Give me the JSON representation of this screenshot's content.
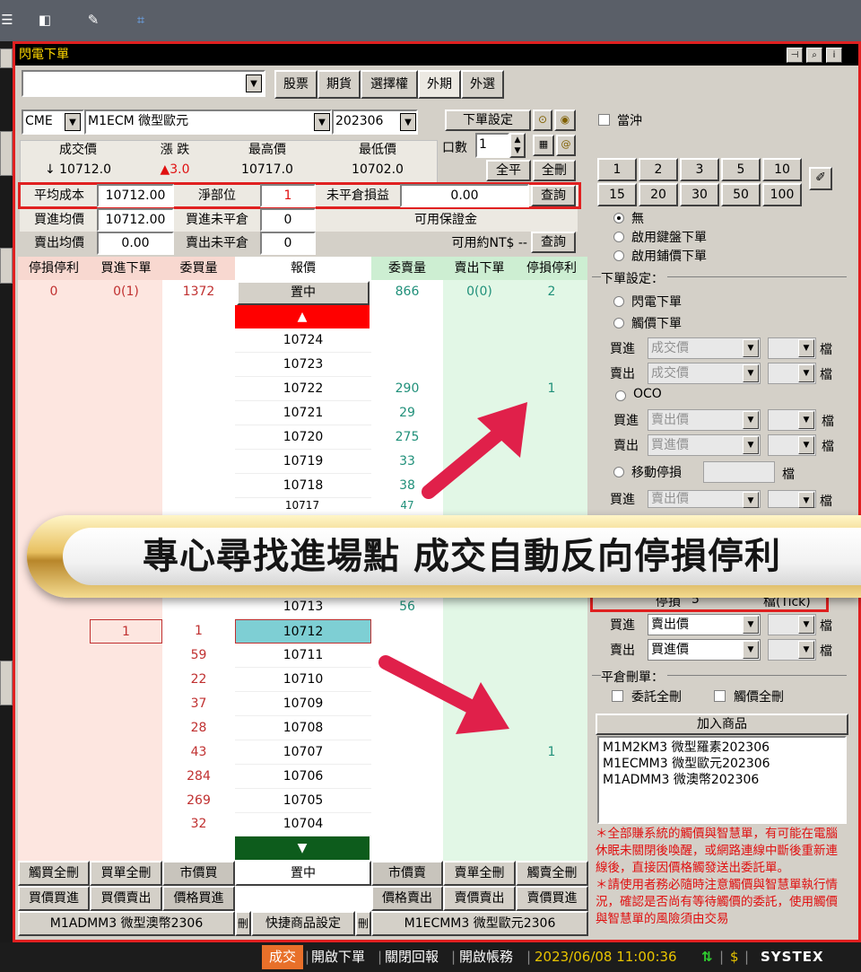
{
  "window_title": "閃電下單",
  "product_tabs": [
    "股票",
    "期貨",
    "選擇權",
    "外期",
    "外選"
  ],
  "exchange": "CME",
  "product": "M1ECM 微型歐元",
  "contract_month": "202306",
  "order_settings_button": "下單設定",
  "lots_label": "口數",
  "lots_value": "1",
  "flatten_all": "全平",
  "delete_all": "全刪",
  "quote_headers": [
    "成交價",
    "漲 跌",
    "最高價",
    "最低價"
  ],
  "quote_values": {
    "last": "↓ 10712.0",
    "change": "▲3.0",
    "high": "10717.0",
    "low": "10702.0"
  },
  "position": {
    "avg_cost_label": "平均成本",
    "avg_cost": "10712.00",
    "net_label": "淨部位",
    "net": "1",
    "unreal_label": "未平倉損益",
    "unreal": "0.00",
    "query": "查詢"
  },
  "buy_row": {
    "label": "買進均價",
    "value": "10712.00",
    "open_label": "買進未平倉",
    "open": "0",
    "margin_label": "可用保證金"
  },
  "sell_row": {
    "label": "賣出均價",
    "value": "0.00",
    "open_label": "賣出未平倉",
    "open": "0",
    "ntd_label": "可用約NT$ --",
    "query": "查詢"
  },
  "ladder_headers": [
    "停損停利",
    "買進下單",
    "委買量",
    "報價",
    "委賣量",
    "賣出下單",
    "停損停利"
  ],
  "center_row": {
    "buy_sl": "0",
    "buy_orders": "0(1)",
    "bid_qty": "1372",
    "price": "置中",
    "ask_qty": "866",
    "sell_orders": "0(0)",
    "sell_sl": "2"
  },
  "ladder_rows": [
    {
      "price": "10724",
      "bid": "",
      "ask": "",
      "sl": ""
    },
    {
      "price": "10723",
      "bid": "",
      "ask": "",
      "sl": ""
    },
    {
      "price": "10722",
      "bid": "",
      "ask": "290",
      "sl": "1"
    },
    {
      "price": "10721",
      "bid": "",
      "ask": "29",
      "sl": ""
    },
    {
      "price": "10720",
      "bid": "",
      "ask": "275",
      "sl": ""
    },
    {
      "price": "10719",
      "bid": "",
      "ask": "33",
      "sl": ""
    },
    {
      "price": "10718",
      "bid": "",
      "ask": "38",
      "sl": ""
    },
    {
      "price": "10713",
      "bid": "",
      "ask": "56",
      "sl": ""
    },
    {
      "price": "10712",
      "bid": "1",
      "ask": "",
      "sl": "",
      "buy": "1"
    },
    {
      "price": "10711",
      "bid": "59",
      "ask": "",
      "sl": ""
    },
    {
      "price": "10710",
      "bid": "22",
      "ask": "",
      "sl": ""
    },
    {
      "price": "10709",
      "bid": "37",
      "ask": "",
      "sl": ""
    },
    {
      "price": "10708",
      "bid": "28",
      "ask": "",
      "sl": ""
    },
    {
      "price": "10707",
      "bid": "43",
      "ask": "",
      "sl": "1"
    },
    {
      "price": "10706",
      "bid": "284",
      "ask": "",
      "sl": ""
    },
    {
      "price": "10705",
      "bid": "269",
      "ask": "",
      "sl": ""
    },
    {
      "price": "10704",
      "bid": "32",
      "ask": "",
      "sl": ""
    }
  ],
  "partial_price": "10717",
  "partial_ask": "47",
  "bottom_row1": [
    "觸買全刪",
    "買單全刪",
    "市價買",
    "置中",
    "市價賣",
    "賣單全刪",
    "觸賣全刪"
  ],
  "bottom_row2": [
    "買價買進",
    "買價賣出",
    "價格買進",
    "",
    "價格賣出",
    "賣價賣出",
    "賣價買進"
  ],
  "bottom_row3": {
    "left": "M1ADMM3 微型澳幣2306",
    "del1": "刪",
    "middle": "快捷商品設定",
    "del2": "刪",
    "right": "M1ECMM3 微型歐元2306"
  },
  "right_panel": {
    "day_trade": "當沖",
    "qty_buttons": [
      "1",
      "2",
      "3",
      "5",
      "10",
      "15",
      "20",
      "30",
      "50",
      "100"
    ],
    "mode_none": "無",
    "mode_keyboard": "啟用鍵盤下單",
    "mode_tile": "啟用鋪價下單",
    "order_settings": "下單設定：",
    "flash_order": "閃電下單",
    "trigger_order": "觸價下單",
    "buy": "買進",
    "sell": "賣出",
    "last_price": "成交價",
    "ask_price": "賣出價",
    "bid_price": "買進價",
    "tick": "檔",
    "oco": "OCO",
    "trailing": "移動停損",
    "stop_loss_label": "停損",
    "stop_loss_value": "5",
    "tick_label": "檔(Tick)",
    "close_delete": "平倉刪單：",
    "delete_orders": "委託全刪",
    "delete_triggers": "觸價全刪",
    "add_product": "加入商品",
    "product_list": [
      "M1M2KM3 微型羅素202306",
      "M1ECMM3 微型歐元202306",
      "M1ADMM3 微澳幣202306"
    ],
    "warning1": "＊全部賺系統的觸價與智慧單，有可能在電腦休眠未關閉後喚醒，或網路連線中斷後重新連線後，直接因價格觸發送出委託單。",
    "warning2": "＊請使用者務必隨時注意觸價與智慧單執行情況，確認是否尚有等待觸價的委託，使用觸價與智慧單的風險須由交易"
  },
  "banner_text": "專心尋找進場點 成交自動反向停損停利",
  "status_bar": {
    "filled": "成交",
    "open_order": "開啟下單",
    "close_report": "關閉回報",
    "open_account": "開啟帳務",
    "datetime": "2023/06/08 11:00:36",
    "brand": "SYSTEX"
  },
  "colors": {
    "red_highlight": "#e02020",
    "buy_bg": "#fde6e0",
    "sell_bg": "#e2f7e6",
    "bid_text": "#c03030",
    "ask_text": "#20907a",
    "banner_gold": "#e8c060",
    "arrow": "#e0204a"
  }
}
